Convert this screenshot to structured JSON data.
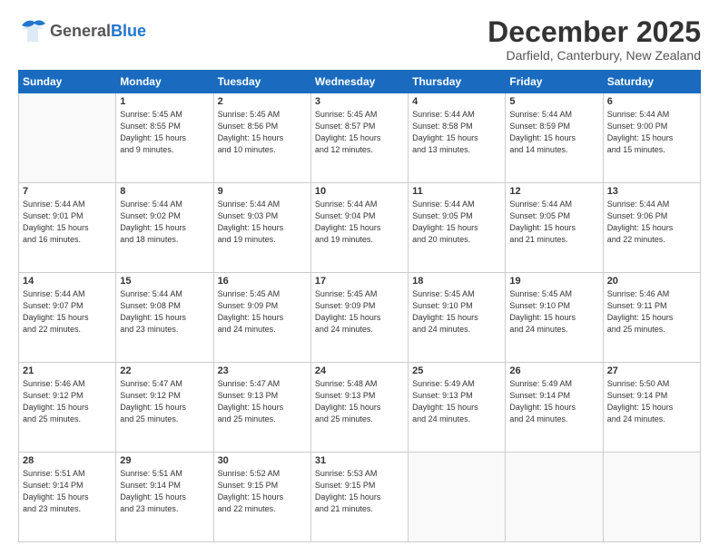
{
  "header": {
    "logo_general": "General",
    "logo_blue": "Blue",
    "month_title": "December 2025",
    "location": "Darfield, Canterbury, New Zealand"
  },
  "days_of_week": [
    "Sunday",
    "Monday",
    "Tuesday",
    "Wednesday",
    "Thursday",
    "Friday",
    "Saturday"
  ],
  "weeks": [
    [
      {
        "day": "",
        "info": ""
      },
      {
        "day": "1",
        "info": "Sunrise: 5:45 AM\nSunset: 8:55 PM\nDaylight: 15 hours\nand 9 minutes."
      },
      {
        "day": "2",
        "info": "Sunrise: 5:45 AM\nSunset: 8:56 PM\nDaylight: 15 hours\nand 10 minutes."
      },
      {
        "day": "3",
        "info": "Sunrise: 5:45 AM\nSunset: 8:57 PM\nDaylight: 15 hours\nand 12 minutes."
      },
      {
        "day": "4",
        "info": "Sunrise: 5:44 AM\nSunset: 8:58 PM\nDaylight: 15 hours\nand 13 minutes."
      },
      {
        "day": "5",
        "info": "Sunrise: 5:44 AM\nSunset: 8:59 PM\nDaylight: 15 hours\nand 14 minutes."
      },
      {
        "day": "6",
        "info": "Sunrise: 5:44 AM\nSunset: 9:00 PM\nDaylight: 15 hours\nand 15 minutes."
      }
    ],
    [
      {
        "day": "7",
        "info": "Sunrise: 5:44 AM\nSunset: 9:01 PM\nDaylight: 15 hours\nand 16 minutes."
      },
      {
        "day": "8",
        "info": "Sunrise: 5:44 AM\nSunset: 9:02 PM\nDaylight: 15 hours\nand 18 minutes."
      },
      {
        "day": "9",
        "info": "Sunrise: 5:44 AM\nSunset: 9:03 PM\nDaylight: 15 hours\nand 19 minutes."
      },
      {
        "day": "10",
        "info": "Sunrise: 5:44 AM\nSunset: 9:04 PM\nDaylight: 15 hours\nand 19 minutes."
      },
      {
        "day": "11",
        "info": "Sunrise: 5:44 AM\nSunset: 9:05 PM\nDaylight: 15 hours\nand 20 minutes."
      },
      {
        "day": "12",
        "info": "Sunrise: 5:44 AM\nSunset: 9:05 PM\nDaylight: 15 hours\nand 21 minutes."
      },
      {
        "day": "13",
        "info": "Sunrise: 5:44 AM\nSunset: 9:06 PM\nDaylight: 15 hours\nand 22 minutes."
      }
    ],
    [
      {
        "day": "14",
        "info": "Sunrise: 5:44 AM\nSunset: 9:07 PM\nDaylight: 15 hours\nand 22 minutes."
      },
      {
        "day": "15",
        "info": "Sunrise: 5:44 AM\nSunset: 9:08 PM\nDaylight: 15 hours\nand 23 minutes."
      },
      {
        "day": "16",
        "info": "Sunrise: 5:45 AM\nSunset: 9:09 PM\nDaylight: 15 hours\nand 24 minutes."
      },
      {
        "day": "17",
        "info": "Sunrise: 5:45 AM\nSunset: 9:09 PM\nDaylight: 15 hours\nand 24 minutes."
      },
      {
        "day": "18",
        "info": "Sunrise: 5:45 AM\nSunset: 9:10 PM\nDaylight: 15 hours\nand 24 minutes."
      },
      {
        "day": "19",
        "info": "Sunrise: 5:45 AM\nSunset: 9:10 PM\nDaylight: 15 hours\nand 24 minutes."
      },
      {
        "day": "20",
        "info": "Sunrise: 5:46 AM\nSunset: 9:11 PM\nDaylight: 15 hours\nand 25 minutes."
      }
    ],
    [
      {
        "day": "21",
        "info": "Sunrise: 5:46 AM\nSunset: 9:12 PM\nDaylight: 15 hours\nand 25 minutes."
      },
      {
        "day": "22",
        "info": "Sunrise: 5:47 AM\nSunset: 9:12 PM\nDaylight: 15 hours\nand 25 minutes."
      },
      {
        "day": "23",
        "info": "Sunrise: 5:47 AM\nSunset: 9:13 PM\nDaylight: 15 hours\nand 25 minutes."
      },
      {
        "day": "24",
        "info": "Sunrise: 5:48 AM\nSunset: 9:13 PM\nDaylight: 15 hours\nand 25 minutes."
      },
      {
        "day": "25",
        "info": "Sunrise: 5:49 AM\nSunset: 9:13 PM\nDaylight: 15 hours\nand 24 minutes."
      },
      {
        "day": "26",
        "info": "Sunrise: 5:49 AM\nSunset: 9:14 PM\nDaylight: 15 hours\nand 24 minutes."
      },
      {
        "day": "27",
        "info": "Sunrise: 5:50 AM\nSunset: 9:14 PM\nDaylight: 15 hours\nand 24 minutes."
      }
    ],
    [
      {
        "day": "28",
        "info": "Sunrise: 5:51 AM\nSunset: 9:14 PM\nDaylight: 15 hours\nand 23 minutes."
      },
      {
        "day": "29",
        "info": "Sunrise: 5:51 AM\nSunset: 9:14 PM\nDaylight: 15 hours\nand 23 minutes."
      },
      {
        "day": "30",
        "info": "Sunrise: 5:52 AM\nSunset: 9:15 PM\nDaylight: 15 hours\nand 22 minutes."
      },
      {
        "day": "31",
        "info": "Sunrise: 5:53 AM\nSunset: 9:15 PM\nDaylight: 15 hours\nand 21 minutes."
      },
      {
        "day": "",
        "info": ""
      },
      {
        "day": "",
        "info": ""
      },
      {
        "day": "",
        "info": ""
      }
    ]
  ]
}
